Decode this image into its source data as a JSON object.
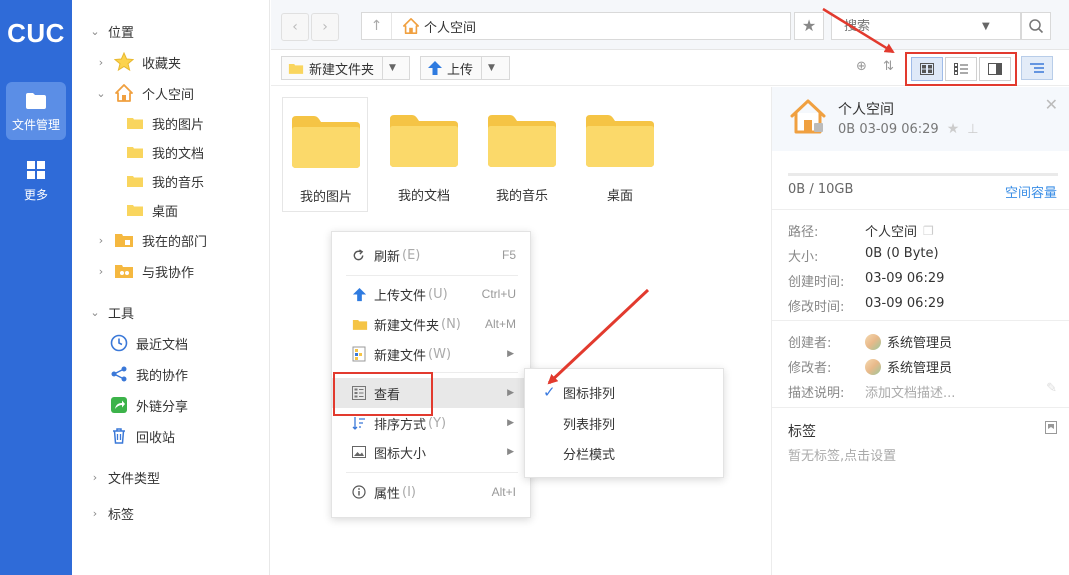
{
  "brand": {
    "logo": "CUC"
  },
  "leftnav": {
    "items": [
      {
        "label": "文件管理",
        "icon": "folder-icon",
        "active": true
      },
      {
        "label": "更多",
        "icon": "grid-icon",
        "active": false
      }
    ]
  },
  "tree": {
    "location": {
      "label": "位置"
    },
    "favorites": {
      "label": "收藏夹"
    },
    "personal": {
      "label": "个人空间",
      "children": [
        "我的图片",
        "我的文档",
        "我的音乐",
        "桌面"
      ]
    },
    "department": {
      "label": "我在的部门"
    },
    "collab": {
      "label": "与我协作"
    },
    "tools": {
      "label": "工具",
      "items": [
        "最近文档",
        "我的协作",
        "外链分享",
        "回收站"
      ]
    },
    "filetypes": {
      "label": "文件类型"
    },
    "tags": {
      "label": "标签"
    }
  },
  "topbar": {
    "path": "个人空间",
    "search_placeholder": "搜索"
  },
  "toolbar": {
    "new_folder": "新建文件夹",
    "upload": "上传"
  },
  "files": [
    {
      "name": "我的图片"
    },
    {
      "name": "我的文档"
    },
    {
      "name": "我的音乐"
    },
    {
      "name": "桌面"
    }
  ],
  "context_menu": {
    "items": [
      {
        "label": "刷新",
        "accel": "(E)",
        "shortcut": "F5",
        "icon": "refresh-icon"
      },
      {
        "label": "上传文件",
        "accel": "(U)",
        "shortcut": "Ctrl+U",
        "icon": "upload-icon"
      },
      {
        "label": "新建文件夹",
        "accel": "(N)",
        "shortcut": "Alt+M",
        "icon": "folder-icon"
      },
      {
        "label": "新建文件",
        "accel": "(W)",
        "shortcut": "",
        "icon": "new-file-icon",
        "submenu": true
      },
      {
        "label": "查看",
        "accel": "",
        "shortcut": "",
        "icon": "view-icon",
        "submenu": true
      },
      {
        "label": "排序方式",
        "accel": "(Y)",
        "shortcut": "",
        "icon": "sort-icon",
        "submenu": true
      },
      {
        "label": "图标大小",
        "accel": "",
        "shortcut": "",
        "icon": "image-size-icon",
        "submenu": true
      },
      {
        "label": "属性",
        "accel": "(I)",
        "shortcut": "Alt+I",
        "icon": "info-icon"
      }
    ]
  },
  "view_submenu": {
    "items": [
      {
        "label": "图标排列",
        "checked": true
      },
      {
        "label": "列表排列",
        "checked": false
      },
      {
        "label": "分栏模式",
        "checked": false
      }
    ]
  },
  "detail": {
    "title": "个人空间",
    "subtitle": "0B 03-09 06:29",
    "quota": "0B / 10GB",
    "quota_link": "空间容量",
    "props": {
      "path_label": "路径:",
      "path_value": "个人空间",
      "size_label": "大小:",
      "size_value": "0B (0 Byte)",
      "created_label": "创建时间:",
      "created_value": "03-09 06:29",
      "modified_label": "修改时间:",
      "modified_value": "03-09 06:29",
      "creator_label": "创建者:",
      "creator_value": "系统管理员",
      "modifier_label": "修改者:",
      "modifier_value": "系统管理员",
      "desc_label": "描述说明:",
      "desc_placeholder": "添加文档描述..."
    },
    "tags_title": "标签",
    "tags_empty": "暂无标签,点击设置"
  },
  "colors": {
    "nav_blue": "#2f6bd8",
    "folder_yellow": "#f9d55e",
    "annotation_red": "#e23a2e",
    "link_blue": "#3a8ee6"
  }
}
